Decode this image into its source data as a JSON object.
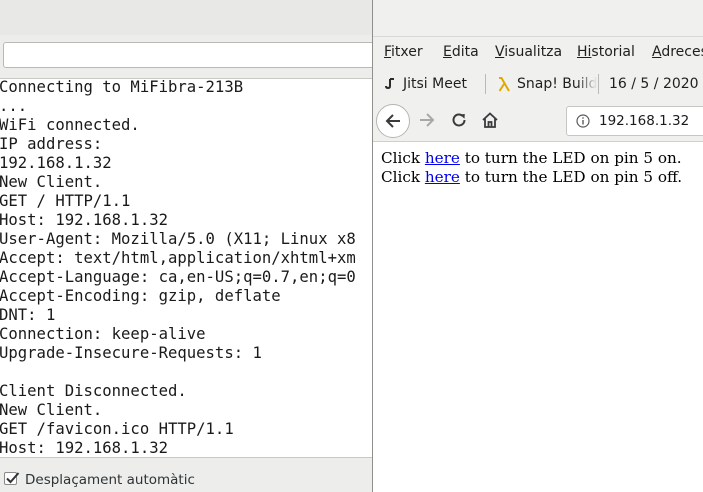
{
  "serial_monitor": {
    "output_lines": [
      "Connecting to MiFibra-213B",
      "...",
      "WiFi connected.",
      "IP address:",
      "192.168.1.32",
      "New Client.",
      "GET / HTTP/1.1",
      "Host: 192.168.1.32",
      "User-Agent: Mozilla/5.0 (X11; Linux x8",
      "Accept: text/html,application/xhtml+xm",
      "Accept-Language: ca,en-US;q=0.7,en;q=0",
      "Accept-Encoding: gzip, deflate",
      "DNT: 1",
      "Connection: keep-alive",
      "Upgrade-Insecure-Requests: 1",
      "",
      "Client Disconnected.",
      "New Client.",
      "GET /favicon.ico HTTP/1.1",
      "Host: 192.168.1.32"
    ],
    "send_input_value": "",
    "autoscroll": {
      "label": "Desplaçament automàtic",
      "checked": true
    }
  },
  "browser": {
    "menu": [
      {
        "first": "F",
        "rest": "itxer"
      },
      {
        "first": "E",
        "rest": "dita"
      },
      {
        "first": "V",
        "rest": "isualitza"
      },
      {
        "first": "Hi",
        "rest": "storial"
      },
      {
        "first": "A",
        "rest": "dreces"
      }
    ],
    "bookmarks": {
      "jitsi": "Jitsi Meet",
      "snap": "Snap! Build",
      "date": "16 / 5 / 2020 -"
    },
    "url": "192.168.1.32",
    "icons": {
      "back": "back-arrow-icon",
      "forward": "forward-arrow-icon",
      "reload": "reload-icon",
      "home": "home-icon",
      "info": "info-icon",
      "jitsi": "jitsi-favicon-icon",
      "snap": "lambda-icon"
    },
    "page": {
      "line_on": {
        "before": "Click ",
        "link": "here",
        "after": " to turn the LED on pin 5 on."
      },
      "line_off": {
        "before": "Click ",
        "link": "here",
        "after": " to turn the LED on pin 5 off."
      }
    }
  },
  "colors": {
    "link": "#0000ee",
    "lambda": "#e0a800",
    "chrome": "#f0f0ee"
  }
}
